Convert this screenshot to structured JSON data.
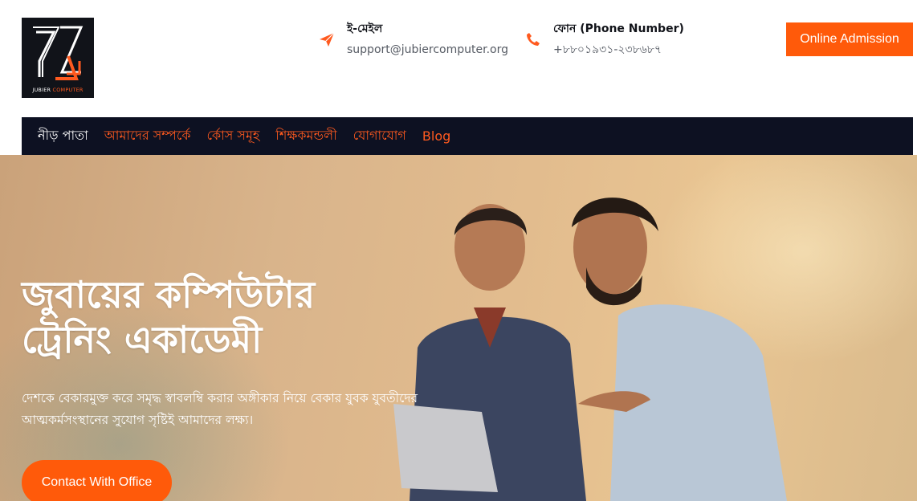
{
  "brand": {
    "logo_text_main": "JUBIER",
    "logo_text_accent": "COMPUTER",
    "accent_color": "#ff5a0a",
    "nav_bg": "#0d1122"
  },
  "header": {
    "email": {
      "icon": "paper-plane-icon",
      "label": "ই-মেইল",
      "value": "support@jubiercomputer.org"
    },
    "phone": {
      "icon": "phone-icon",
      "label": "ফোন (Phone Number)",
      "value": "+৮৮০১৯৩১-২৩৮৬৮৭"
    },
    "admission_label": "Online Admission"
  },
  "nav": {
    "items": [
      {
        "label": "নীড় পাতা",
        "active": true
      },
      {
        "label": "আমাদের সম্পর্কে",
        "active": false
      },
      {
        "label": "র্কোস সমূহ",
        "active": false
      },
      {
        "label": "শিক্ষকমন্ডলী",
        "active": false
      },
      {
        "label": "যোগাযোগ",
        "active": false
      },
      {
        "label": "Blog",
        "active": false
      }
    ]
  },
  "hero": {
    "title_line1": "জুবায়ের কম্পিউটার",
    "title_line2": "ট্রেনিং একাডেমী",
    "description": "দেশকে বেকারমুক্ত করে সমৃদ্ধ স্বাবলম্বি করার অঙ্গীকার নিয়ে বেকার যুবক যুবতীদের আত্মকর্মসংস্থানের সুযোগ সৃষ্টিই আমাদের লক্ষ্য।",
    "contact_button": "Contact With Office"
  }
}
